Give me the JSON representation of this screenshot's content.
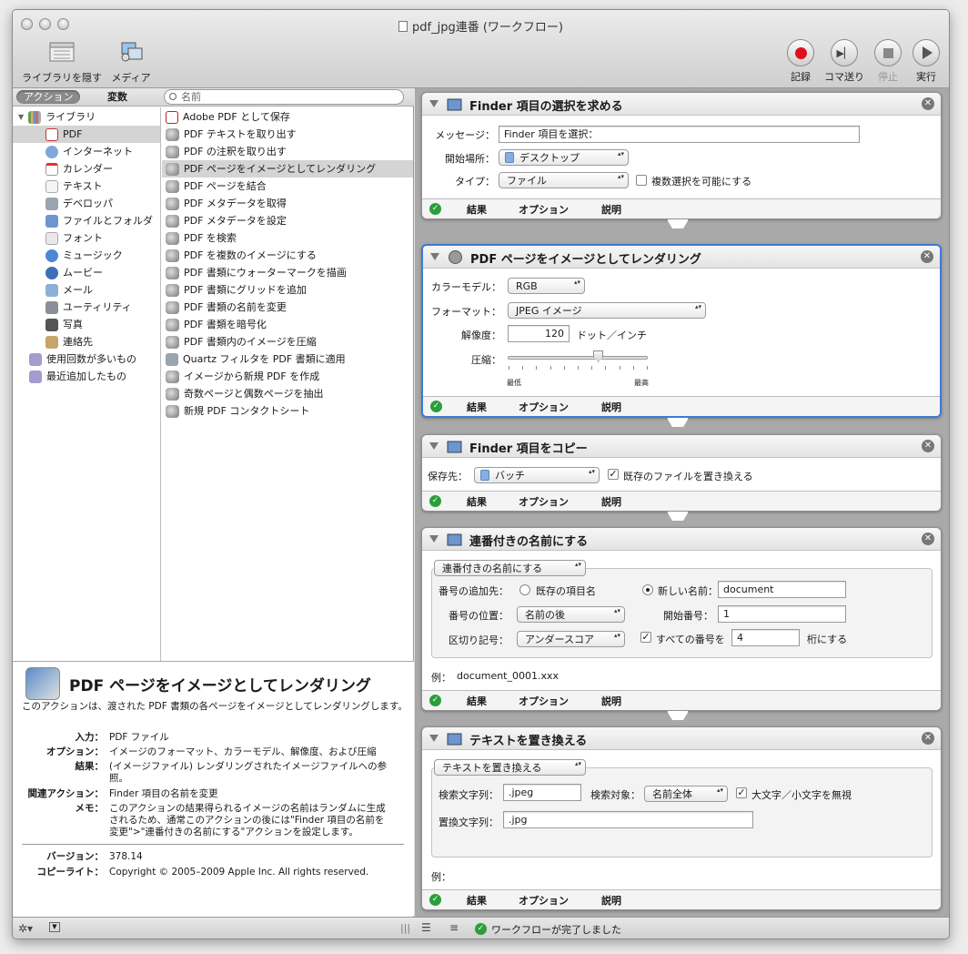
{
  "window": {
    "title": "pdf_jpg連番 (ワークフロー)"
  },
  "toolbar": {
    "hide_library": "ライブラリを隠す",
    "media": "メディア",
    "record": "記録",
    "step": "コマ送り",
    "stop": "停止",
    "run": "実行"
  },
  "library": {
    "tab_actions": "アクション",
    "tab_variables": "変数",
    "search_placeholder": "名前",
    "root": "ライブラリ",
    "items": [
      "PDF",
      "インターネット",
      "カレンダー",
      "テキスト",
      "デベロッパ",
      "ファイルとフォルダ",
      "フォント",
      "ミュージック",
      "ムービー",
      "メール",
      "ユーティリティ",
      "写真",
      "連絡先"
    ],
    "smart": [
      "使用回数が多いもの",
      "最近追加したもの"
    ]
  },
  "actions": [
    "Adobe PDF として保存",
    "PDF テキストを取り出す",
    "PDF の注釈を取り出す",
    "PDF ページをイメージとしてレンダリング",
    "PDF ページを結合",
    "PDF メタデータを取得",
    "PDF メタデータを設定",
    "PDF を検索",
    "PDF を複数のイメージにする",
    "PDF 書類にウォーターマークを描画",
    "PDF 書類にグリッドを追加",
    "PDF 書類の名前を変更",
    "PDF 書類を暗号化",
    "PDF 書類内のイメージを圧縮",
    "Quartz フィルタを PDF 書類に適用",
    "イメージから新規 PDF を作成",
    "奇数ページと偶数ページを抽出",
    "新規 PDF コンタクトシート"
  ],
  "description": {
    "title": "PDF ページをイメージとしてレンダリング",
    "text": "このアクションは、渡された PDF 書類の各ページをイメージとしてレンダリングします。",
    "input_k": "入力：",
    "input_v": "PDF ファイル",
    "options_k": "オプション：",
    "options_v": "イメージのフォーマット、カラーモデル、解像度、および圧縮",
    "result_k": "結果：",
    "result_v": "(イメージファイル) レンダリングされたイメージファイルへの参照。",
    "related_k": "関連アクション：",
    "related_v": "Finder 項目の名前を変更",
    "memo_k": "メモ：",
    "memo_v": "このアクションの結果得られるイメージの名前はランダムに生成されるため、通常このアクションの後には\"Finder 項目の名前を変更\">\"連番付きの名前にする\"アクションを設定します。",
    "version_k": "バージョン：",
    "version_v": "378.14",
    "copyright_k": "コピーライト：",
    "copyright_v": "Copyright © 2005–2009 Apple Inc.  All rights reserved."
  },
  "common": {
    "results": "結果",
    "options": "オプション",
    "description": "説明"
  },
  "card1": {
    "title": "Finder 項目の選択を求める",
    "message_label": "メッセージ：",
    "message_value": "Finder 項目を選択：",
    "start_label": "開始場所：",
    "start_value": "デスクトップ",
    "type_label": "タイプ：",
    "type_value": "ファイル",
    "multi": "複数選択を可能にする"
  },
  "card2": {
    "title": "PDF ページをイメージとしてレンダリング",
    "color_label": "カラーモデル：",
    "color_value": "RGB",
    "format_label": "フォーマット：",
    "format_value": "JPEG イメージ",
    "res_label": "解像度：",
    "res_value": "120",
    "res_unit": "ドット／インチ",
    "comp_label": "圧縮：",
    "comp_min": "最低",
    "comp_max": "最高",
    "compression_level": 0.65
  },
  "card3": {
    "title": "Finder 項目をコピー",
    "dest_label": "保存先：",
    "dest_value": "バッチ",
    "replace": "既存のファイルを置き換える"
  },
  "card4": {
    "title": "連番付きの名前にする",
    "mode": "連番付きの名前にする",
    "add_label": "番号の追加先：",
    "existing": "既存の項目名",
    "newname_label": "新しい名前：",
    "newname_value": "document",
    "pos_label": "番号の位置：",
    "pos_value": "名前の後",
    "start_label": "開始番号：",
    "start_value": "1",
    "sep_label": "区切り記号：",
    "sep_value": "アンダースコア",
    "all_label": "すべての番号を",
    "digits_value": "4",
    "digits_unit": "桁にする",
    "example_label": "例：",
    "example_value": "document_0001.xxx"
  },
  "card5": {
    "title": "テキストを置き換える",
    "mode": "テキストを置き換える",
    "find_label": "検索文字列：",
    "find_value": ".jpeg",
    "target_label": "検索対象：",
    "target_value": "名前全体",
    "ignore_case": "大文字／小文字を無視",
    "replace_label": "置換文字列：",
    "replace_value": ".jpg",
    "example_label": "例："
  },
  "status": {
    "text": "ワークフローが完了しました"
  }
}
